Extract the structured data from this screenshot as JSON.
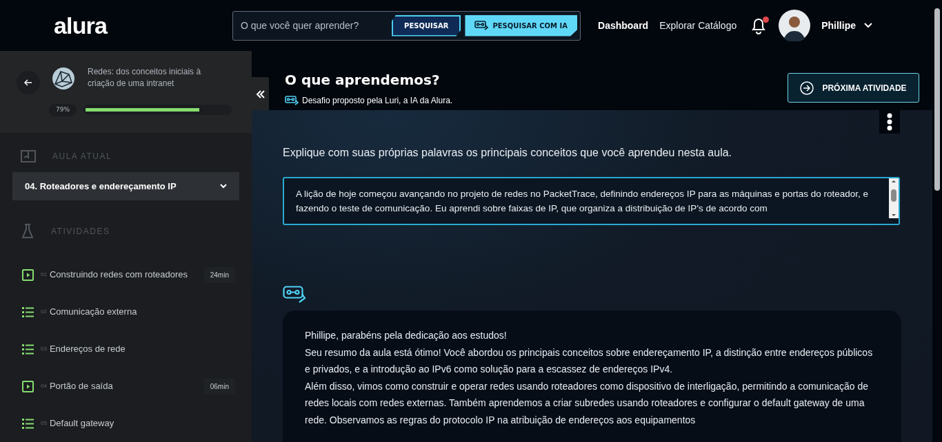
{
  "header": {
    "logo": "alura",
    "search": {
      "placeholder": "O que você quer aprender?",
      "button": "PESQUISAR",
      "ai_button": "PESQUISAR COM IA"
    },
    "nav": [
      "Dashboard",
      "Explorar Catálogo"
    ],
    "notification_unread": true,
    "user": "Phillipe"
  },
  "sidebar": {
    "course_title": "Redes: dos conceitos iniciais à criação de uma intranet",
    "progress_label": "79%",
    "level": 0.79,
    "current_lesson_heading": "AULA ATUAL",
    "current_lesson": "04. Roteadores e endereçamento IP",
    "activities_heading": "ATIVIDADES",
    "activities": [
      {
        "kind": "video",
        "number": "01",
        "title": "Construindo redes com roteadores",
        "duration": "24min"
      },
      {
        "kind": "list",
        "number": "02",
        "title": "Comunicação externa"
      },
      {
        "kind": "list",
        "number": "03",
        "title": "Endereços de rede"
      },
      {
        "kind": "video",
        "number": "04",
        "title": "Portão de saída",
        "duration": "06min"
      },
      {
        "kind": "list",
        "number": "05",
        "title": "Default gateway"
      }
    ]
  },
  "activity": {
    "title": "O que aprendemos?",
    "subtitle": "Desafio proposto pela Luri, a IA da Alura.",
    "next_button": "PRÓXIMA ATIVIDADE",
    "question": "Explique com suas próprias palavras os principais conceitos que você aprendeu nesta aula.",
    "answer": "A lição de hoje começou avançando no projeto de redes no PacketTrace, definindo endereços IP para as máquinas e portas do roteador, e fazendo o teste de comunicação. Eu aprendi sobre faixas de IP, que organiza a distribuição de IP's de acordo com",
    "feedback": [
      "Phillipe, parabéns pela dedicação aos estudos!",
      "Seu resumo da aula está ótimo! Você abordou os principais conceitos sobre endereçamento IP, a distinção entre endereços públicos e privados, e a introdução ao IPv6 como solução para a escassez de endereços IPv4.",
      "Além disso, vimos como construir e operar redes usando roteadores como dispositivo de interligação, permitindo a comunicação de redes locais com redes externas. Também aprendemos a criar subredes usando roteadores e configurar o default gateway de uma rede. Observamos as regras do protocolo IP na atribuição de endereços aos equipamentos"
    ]
  }
}
